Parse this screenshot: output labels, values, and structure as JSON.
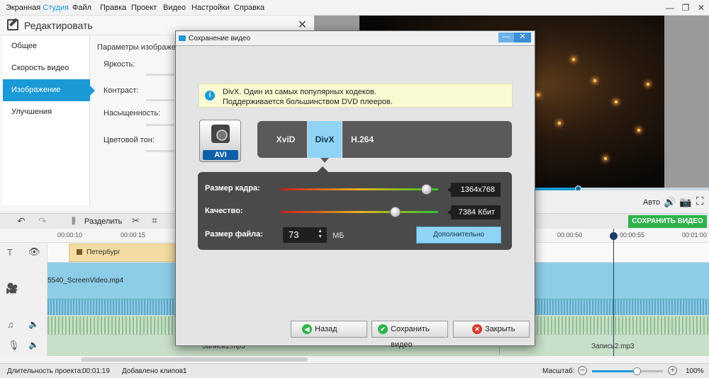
{
  "app": {
    "title_part1": "Экранная",
    "title_part2": "Студия",
    "menu": [
      "Файл",
      "Правка",
      "Проект",
      "Видео",
      "Настройки",
      "Справка"
    ],
    "accent_color": "#1a9ad6"
  },
  "edit_panel": {
    "title": "Редактировать",
    "nav": [
      "Общее",
      "Скорость видео",
      "Изображение",
      "Улучшения"
    ],
    "active_nav": "Изображение",
    "section_title": "Параметры изображе",
    "params": [
      "Яркость:",
      "Контраст:",
      "Насыщенность:",
      "Цветовой тон:"
    ]
  },
  "preview": {
    "auto_label": "Авто",
    "icons": [
      "volume-icon",
      "camera-icon",
      "fullscreen-icon"
    ]
  },
  "toolbar": {
    "split_label": "Разделить",
    "save_video_label": "СОХРАНИТЬ ВИДЕО",
    "save_color": "#2db34a"
  },
  "timeline": {
    "ticks": [
      "00:00:10",
      "00:00:15",
      "00:00:50",
      "00:00:55",
      "00:01:00"
    ],
    "title_clip": "Петербург",
    "video_clip": "5540_ScreenVideo.mp4",
    "audio_clip_1": "Запись1.mp3",
    "audio_clip_2": "Запись2.mp3"
  },
  "status": {
    "duration_label": "Длительность проекта:",
    "duration_value": "00:01:19",
    "clips_label": "Добавлено клипов:",
    "clips_value": "1",
    "zoom_label": "Масштаб:",
    "zoom_value": "100%",
    "zoom_fraction": 0.64
  },
  "dialog": {
    "title": "Сохранение видео",
    "info_line1": "DivX. Один из самых популярных кодеков.",
    "info_line2": "Поддерживается большинством DVD плееров.",
    "format_label": "AVI",
    "codecs": [
      "XviD",
      "DivX",
      "H.264"
    ],
    "selected_codec": "DivX",
    "frame_size_label": "Размер кадра:",
    "frame_size_value": "1364x768",
    "frame_size_fraction": 0.93,
    "quality_label": "Качество:",
    "quality_value": "7384 Кбит",
    "quality_fraction": 0.73,
    "file_size_label": "Размер файла:",
    "file_size_value": "73",
    "file_size_unit": "МБ",
    "advanced_label": "Дополнительно",
    "back_label": "Назад",
    "save_label": "Сохранить видео",
    "close_label": "Закрыть",
    "minimize_glyph": "—",
    "close_glyph": "✕"
  }
}
